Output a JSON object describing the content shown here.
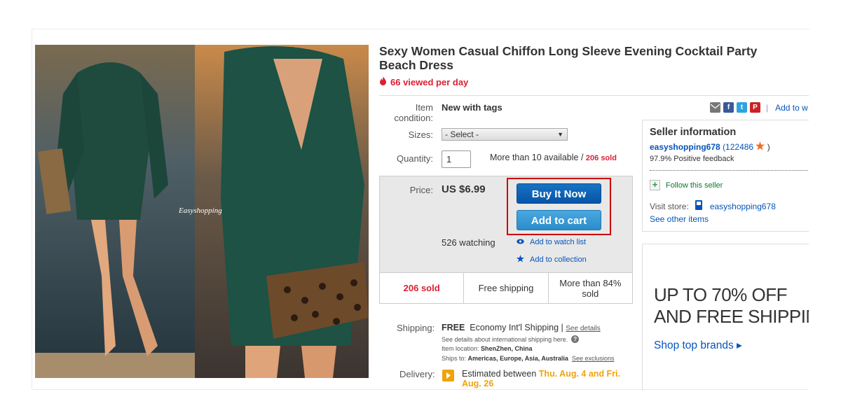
{
  "listing": {
    "title": "Sexy Women Casual Chiffon Long Sleeve Evening Cocktail Party Beach Dress",
    "viewed": "66 viewed per day",
    "photo_watermark": "Easyshopping"
  },
  "details": {
    "condition_label": "Item condition:",
    "condition_value": "New with tags",
    "sizes_label": "Sizes:",
    "sizes_selected": "- Select -",
    "quantity_label": "Quantity:",
    "quantity_value": "1",
    "availability": "More than 10 available /",
    "sold_inline": "206 sold"
  },
  "purchase": {
    "price_label": "Price:",
    "price": "US $6.99",
    "buy_now": "Buy It Now",
    "add_to_cart": "Add to cart",
    "watching": "526 watching",
    "add_watch": "Add to watch list",
    "add_collection": "Add to collection",
    "stats": [
      "206 sold",
      "Free shipping",
      "More than 84% sold"
    ]
  },
  "shipping": {
    "label": "Shipping:",
    "free": "FREE",
    "method": "Economy Int'l Shipping |",
    "see_details": "See details",
    "intl_note": "See details about international shipping here.",
    "location_label": "Item location:",
    "location": "ShenZhen, China",
    "ships_label": "Ships to:",
    "ships_to": "Americas, Europe, Asia, Australia",
    "see_exclusions": "See exclusions",
    "delivery_label": "Delivery:",
    "delivery_prefix": "Estimated between",
    "delivery_dates": "Thu. Aug. 4 and Fri. Aug. 26"
  },
  "share": {
    "add_to": "Add to w"
  },
  "seller": {
    "heading": "Seller information",
    "name": "easyshopping678",
    "score": "(122486",
    "score_close": ")",
    "feedback": "97.9% Positive feedback",
    "follow": "Follow this seller",
    "visit_label": "Visit store:",
    "store": "easyshopping678",
    "other_items": "See other items"
  },
  "ad": {
    "line1": "UP TO 70% OFF",
    "line2": "AND FREE SHIPPIN",
    "cta": "Shop top brands ▸"
  },
  "colors": {
    "ebay_blue": "#0654ba",
    "buy_button": "#0654a8",
    "cart_button": "#2b8ccb",
    "highlight_red": "#dd1e31",
    "delivery_gold": "#f0a30a"
  }
}
